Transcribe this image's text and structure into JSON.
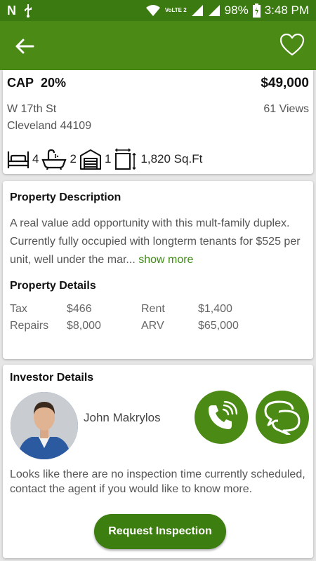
{
  "status_bar": {
    "time": "3:48 PM",
    "battery": "98%",
    "network": "VoLTE 2",
    "left_icons": [
      "n-icon",
      "usb-icon"
    ],
    "right_icons": [
      "wifi-icon",
      "signal-icon",
      "signal-icon",
      "battery-charging-icon"
    ]
  },
  "app_bar": {
    "back_icon": "arrow-left-icon",
    "favorite_icon": "heart-outline-icon",
    "color": "#4c8a16"
  },
  "summary": {
    "cap_label": "CAP",
    "cap_value": "20%",
    "price": "$49,000",
    "street": "W 17th St",
    "city": "Cleveland 44109",
    "views": "61 Views",
    "beds": "4",
    "baths": "2",
    "garage": "1",
    "area": "1,820 Sq.Ft"
  },
  "description": {
    "title": "Property Description",
    "text": "A real value add opportunity with this mult-family duplex. Currently fully occupied with longterm tenants for $525 per unit, well under the mar... ",
    "show_more": "show more"
  },
  "details": {
    "title": "Property Details",
    "rows": [
      {
        "label1": "Tax",
        "value1": "$466",
        "label2": "Rent",
        "value2": "$1,400"
      },
      {
        "label1": "Repairs",
        "value1": "$8,000",
        "label2": "ARV",
        "value2": "$65,000"
      }
    ]
  },
  "investor": {
    "title": "Investor Details",
    "name": "John Makrylos",
    "call_icon": "phone-call-icon",
    "chat_icon": "chat-bubbles-icon",
    "note": "Looks like there are no inspection time currently scheduled, contact the agent if you would like to know more.",
    "request_button": "Request Inspection"
  },
  "colors": {
    "primary": "#4c8a16",
    "status_bar": "#3b7a10",
    "accent_text": "#3d8a14"
  }
}
